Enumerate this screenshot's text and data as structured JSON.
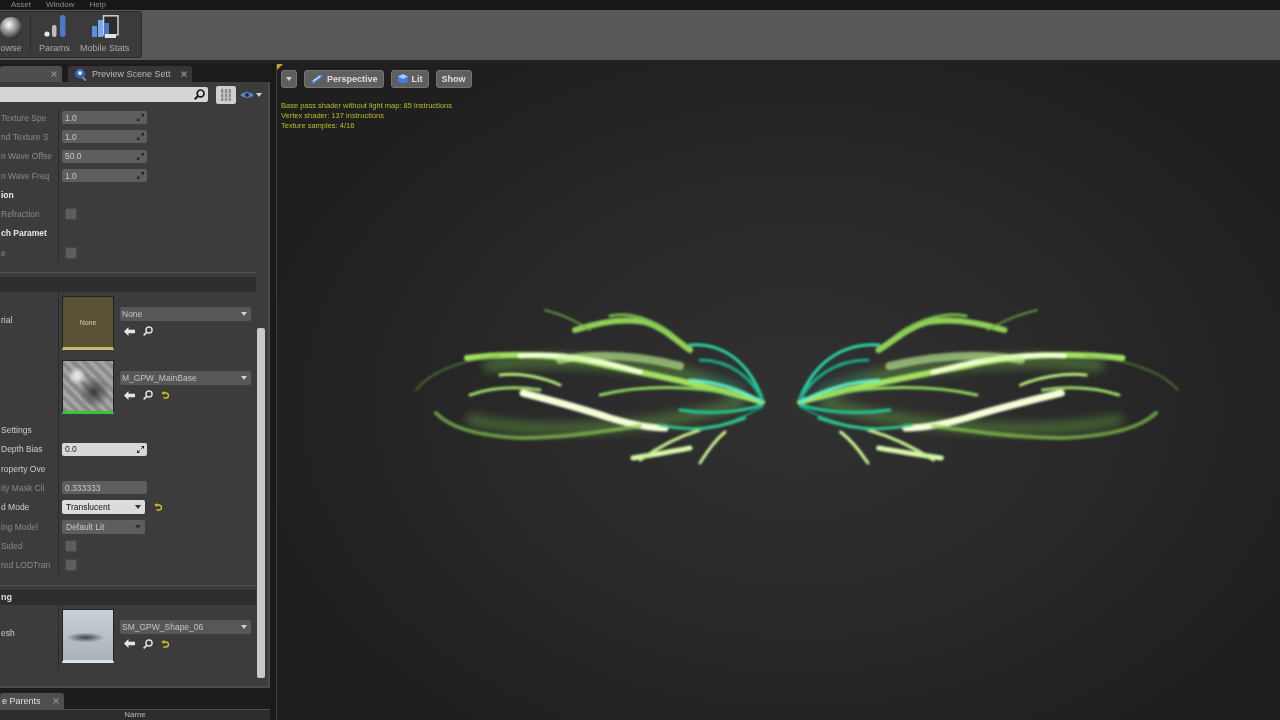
{
  "menu_bar": {
    "items": [
      "Asset",
      "Window",
      "Help"
    ]
  },
  "toolbar": {
    "buttons": [
      {
        "kind": "browse",
        "label": "owse"
      },
      {
        "kind": "params",
        "label": "Params"
      },
      {
        "kind": "mobile_stats",
        "label": "Mobile Stats"
      }
    ]
  },
  "details": {
    "tabs": [
      {
        "kind": "plain",
        "selected": true
      },
      {
        "kind": "preview",
        "label": "Preview Scene Sett",
        "selected": false
      }
    ],
    "sections": [
      {
        "kind": "continued",
        "rows": [
          {
            "kind": "number",
            "label": "Texture Spe",
            "value": "1.0",
            "disabled": true
          },
          {
            "kind": "number",
            "label": "nd Texture S",
            "value": "1.0",
            "disabled": true
          },
          {
            "kind": "number",
            "label": "n Wave Offse",
            "value": "50.0",
            "disabled": true
          },
          {
            "kind": "number",
            "label": "n Wave Freq",
            "value": "1.0",
            "disabled": true
          },
          {
            "kind": "group",
            "label": "ion"
          },
          {
            "kind": "checkbox",
            "label": "Refraction",
            "checked": false,
            "disabled": true
          },
          {
            "kind": "group",
            "label": "ch Paramet"
          },
          {
            "kind": "checkbox",
            "label": "e",
            "checked": false,
            "disabled": true
          }
        ]
      },
      {
        "kind": "category",
        "rows": [
          {
            "kind": "asset",
            "label": "rial",
            "thumbnail": {
              "kind": "blank",
              "label": "None"
            },
            "value": "None",
            "modified": false
          },
          {
            "kind": "asset",
            "thumbnail": {
              "kind": "material"
            },
            "value": "M_GPW_MainBase",
            "modified": true
          },
          {
            "kind": "struct",
            "label": "Settings"
          },
          {
            "kind": "number",
            "label": "Depth Bias",
            "value": "0.0",
            "disabled": false
          },
          {
            "kind": "struct",
            "label": "roperty Ove"
          },
          {
            "kind": "text",
            "label": "ity Mask Cli",
            "value": "0.333333",
            "disabled": true
          },
          {
            "kind": "dropdown",
            "label": "d Mode",
            "value": "Translucent",
            "disabled": false,
            "modified": true
          },
          {
            "kind": "dropdown",
            "label": "ing Model",
            "value": "Default Lit",
            "disabled": true,
            "modified": false
          },
          {
            "kind": "checkbox",
            "label": "Sided",
            "checked": false,
            "disabled": true
          },
          {
            "kind": "checkbox",
            "label": "red LODTran",
            "checked": false,
            "disabled": true
          }
        ]
      },
      {
        "kind": "category",
        "title": "ng",
        "rows": [
          {
            "kind": "asset",
            "label": "esh",
            "thumbnail": {
              "kind": "mesh"
            },
            "value": "SM_GPW_Shape_06",
            "modified": true
          }
        ]
      }
    ]
  },
  "bottom_panel": {
    "tabs": [
      {
        "label": "e Parents",
        "selected": true
      }
    ],
    "columns": [
      "Name"
    ]
  },
  "viewport": {
    "buttons": [
      {
        "kind": "menu"
      },
      {
        "kind": "perspective",
        "label": "Perspective"
      },
      {
        "kind": "lit",
        "label": "Lit"
      },
      {
        "kind": "show",
        "label": "Show"
      }
    ],
    "stats": [
      "Base pass shader without light map: 85 instructions",
      "Vertex shader: 137 instructions",
      "Texture samples: 4/16"
    ]
  }
}
